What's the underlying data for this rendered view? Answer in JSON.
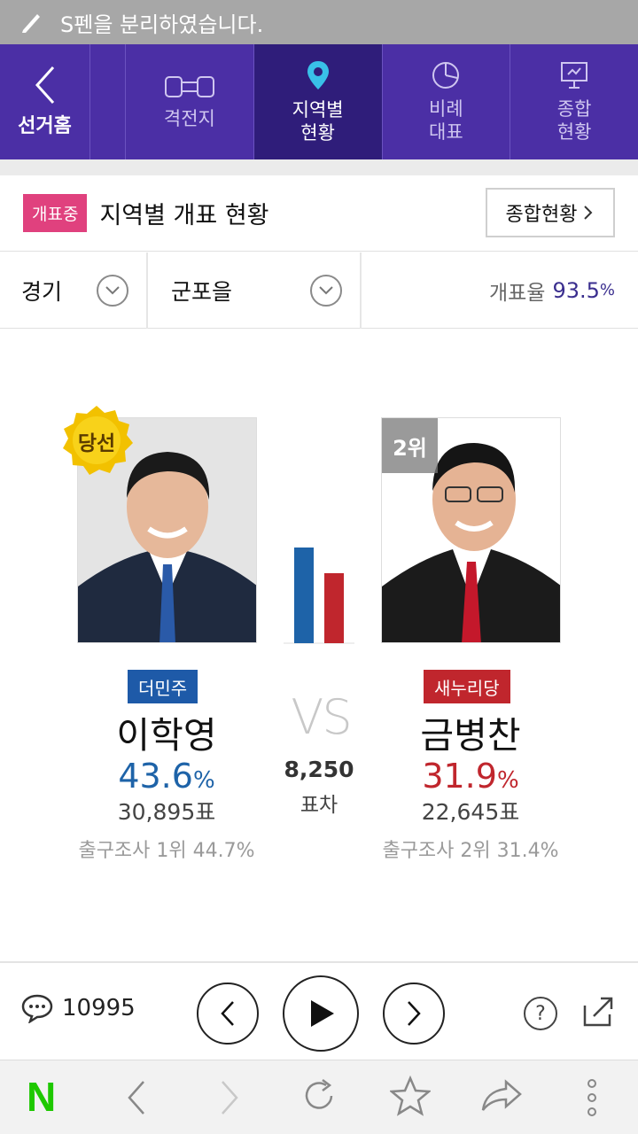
{
  "status_bar": {
    "message": "S펜을 분리하였습니다."
  },
  "nav": {
    "back_label": "선거홈",
    "tabs": [
      {
        "label": "격전지",
        "icon": "battlefield-icon",
        "active": false
      },
      {
        "label": "지역별\n현황",
        "icon": "location-pin-icon",
        "active": true
      },
      {
        "label": "비례\n대표",
        "icon": "pie-chart-icon",
        "active": false
      },
      {
        "label": "종합\n현황",
        "icon": "presentation-board-icon",
        "active": false
      }
    ]
  },
  "header": {
    "live_badge": "개표중",
    "title": "지역별 개표 현황",
    "summary_button": "종합현황"
  },
  "filters": {
    "region": "경기",
    "district": "군포을",
    "count_rate_label": "개표율",
    "count_rate_value": "93.5",
    "count_rate_unit": "%"
  },
  "candidates": [
    {
      "winner_badge": "당선",
      "party": "더민주",
      "party_color": "#1e5aa8",
      "name": "이학영",
      "percent": "43.6",
      "percent_unit": "%",
      "votes": "30,895표",
      "exit_poll": "출구조사 1위 44.7%"
    },
    {
      "rank_badge": "2위",
      "party": "새누리당",
      "party_color": "#c0262d",
      "name": "금병찬",
      "percent": "31.9",
      "percent_unit": "%",
      "votes": "22,645표",
      "exit_poll": "출구조사 2위 31.4%"
    }
  ],
  "versus": {
    "vs_text": "VS",
    "margin": "8,250",
    "margin_label": "표차"
  },
  "bar_chart": {
    "values": [
      43.6,
      31.9
    ],
    "colors": [
      "#1e63a8",
      "#c0262d"
    ]
  },
  "controls": {
    "comment_count": "10995"
  },
  "browser": {
    "logo": "N",
    "logo_color": "#1ec800"
  }
}
